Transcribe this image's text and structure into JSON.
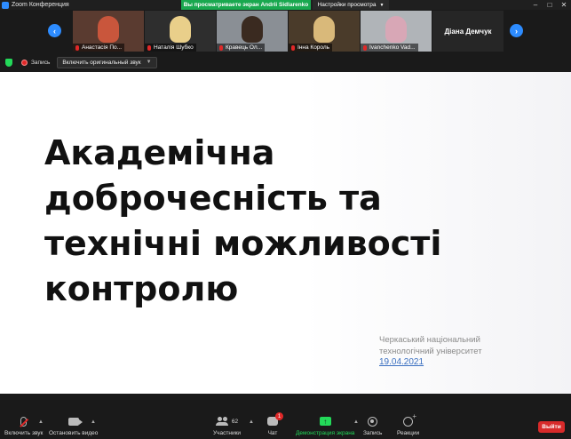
{
  "window": {
    "title": "Zoom Конференция",
    "share_banner": "Вы просматриваете экран Andrii Sidlarenko",
    "view_settings": "Настройки просмотра",
    "controls": [
      "–",
      "□",
      "✕"
    ]
  },
  "participants": [
    {
      "name": "Анастасія По...",
      "muted": true,
      "bg": "#5a3b30",
      "face": "#c9563c"
    },
    {
      "name": "Наталія Шубко",
      "muted": true,
      "bg": "#2e2e2e",
      "face": "#e9cf8a"
    },
    {
      "name": "Кравець Ол...",
      "muted": true,
      "bg": "#8a8f95",
      "face": "#3a2a20"
    },
    {
      "name": "Інна Король",
      "muted": true,
      "bg": "#4a3b2a",
      "face": "#d9b97a"
    },
    {
      "name": "Ivanchenko Vad...",
      "muted": true,
      "bg": "#b0b4b8",
      "face": "#d8a7b6"
    },
    {
      "name": "Діана Демчук",
      "muted": false
    }
  ],
  "nav": {
    "prev_icon": "‹",
    "next_icon": "›"
  },
  "recording": {
    "label": "Запись",
    "original_sound_button": "Включить оригинальный звук"
  },
  "slide": {
    "title_lines": [
      "Академічна",
      "доброчесність та",
      "технічні можливості",
      "контролю"
    ],
    "org_lines": [
      "Черкаський національний",
      "технологічний університет"
    ],
    "date": "19.04.2021"
  },
  "toolbar": {
    "unmute": "Включить звук",
    "start_video": "Остановить видео",
    "participants_label": "Участники",
    "participants_count": "62",
    "chat": "Чат",
    "chat_badge": "1",
    "share": "Демонстрация экрана",
    "record": "Запись",
    "reactions": "Реакции",
    "leave": "Выйти"
  },
  "colors": {
    "accent": "#2d8cff",
    "share_green": "#19a84f",
    "leave_red": "#d82a2a"
  }
}
